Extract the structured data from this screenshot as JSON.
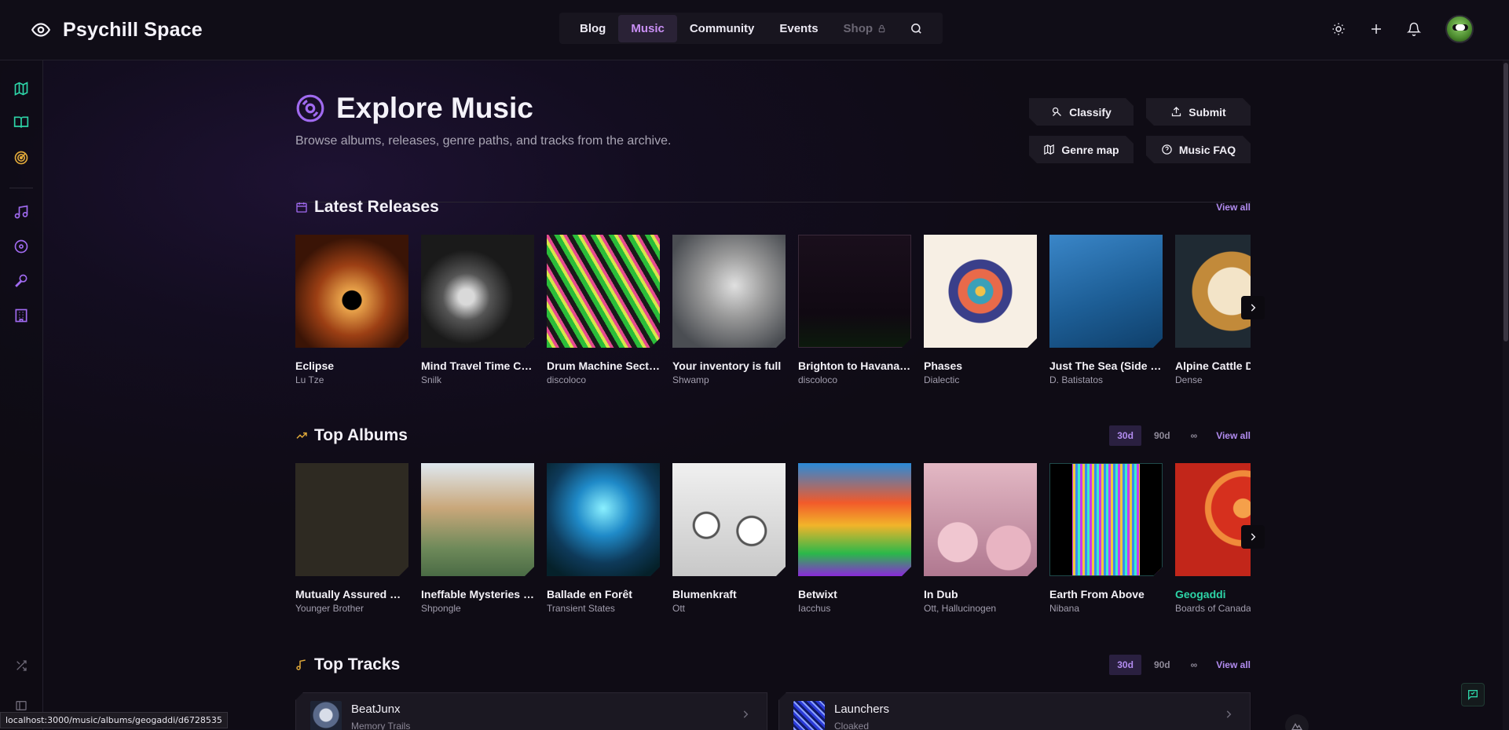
{
  "brand": {
    "name": "Psychill Space"
  },
  "nav": {
    "items": [
      {
        "label": "Blog",
        "active": false
      },
      {
        "label": "Music",
        "active": true
      },
      {
        "label": "Community",
        "active": false
      },
      {
        "label": "Events",
        "active": false
      },
      {
        "label": "Shop",
        "active": false,
        "locked": true
      }
    ]
  },
  "page": {
    "title": "Explore Music",
    "subtitle": "Browse albums, releases, genre paths, and tracks from the archive.",
    "buttons": {
      "classify": "Classify",
      "submit": "Submit",
      "genre_map": "Genre map",
      "faq": "Music FAQ"
    }
  },
  "latest": {
    "title": "Latest Releases",
    "view_all": "View all",
    "items": [
      {
        "title": "Eclipse",
        "artist": "Lu Tze"
      },
      {
        "title": "Mind Travel Time Co...",
        "artist": "Snilk"
      },
      {
        "title": "Drum Machine Secto...",
        "artist": "discoloco"
      },
      {
        "title": "Your inventory is full",
        "artist": "Shwamp"
      },
      {
        "title": "Brighton to Havana (...",
        "artist": "discoloco"
      },
      {
        "title": "Phases",
        "artist": "Dialectic"
      },
      {
        "title": "Just The Sea (Side Li...",
        "artist": "D. Batistatos"
      },
      {
        "title": "Alpine Cattle Dr",
        "artist": "Dense"
      }
    ]
  },
  "albums": {
    "title": "Top Albums",
    "ranges": [
      "30d",
      "90d",
      "∞"
    ],
    "active_range": "30d",
    "view_all": "View all",
    "items": [
      {
        "title": "Mutually Assured Dis...",
        "artist": "Younger Brother"
      },
      {
        "title": "Ineffable Mysteries F...",
        "artist": "Shpongle"
      },
      {
        "title": "Ballade en Forêt",
        "artist": "Transient States"
      },
      {
        "title": "Blumenkraft",
        "artist": "Ott"
      },
      {
        "title": "Betwixt",
        "artist": "Iacchus"
      },
      {
        "title": "In Dub",
        "artist": "Ott, Hallucinogen"
      },
      {
        "title": "Earth From Above",
        "artist": "Nibana"
      },
      {
        "title": "Geogaddi",
        "artist": "Boards of Canada",
        "hovered": true
      }
    ]
  },
  "tracks": {
    "title": "Top Tracks",
    "ranges": [
      "30d",
      "90d",
      "∞"
    ],
    "active_range": "30d",
    "view_all": "View all",
    "items": [
      {
        "title": "BeatJunx",
        "artist": "Memory Trails"
      },
      {
        "title": "Launchers",
        "artist": "Cloaked"
      }
    ]
  },
  "status_url": "localhost:3000/music/albums/geogaddi/d6728535",
  "colors": {
    "accent": "#b28cf0",
    "teal": "#2dd4a7",
    "gold": "#e0a93a",
    "purple_icon": "#a06af0"
  }
}
